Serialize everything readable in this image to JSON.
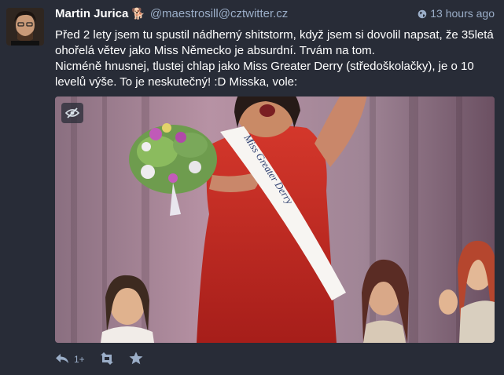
{
  "status": {
    "display_name": "Martin Jurica",
    "emoji": "🐕",
    "acct": "@maestrosill@cztwitter.cz",
    "time": "13 hours ago",
    "content": [
      "Před 2 lety jsem tu spustil nádherný shitstorm, když jsem si dovolil napsat, že 35letá ohořelá větev jako Miss Německo je absurdní. Trvám na tom.",
      "Nicméně hnusnej, tlustej chlap jako Miss Greater Derry (středoškolačky), je o 10 levelů výše. To je neskutečný! :D Misska, vole:"
    ],
    "sash_text": "Miss Greater Derry",
    "reply_count": "1+"
  },
  "icons": {
    "visibility": "globe-icon",
    "hide_media": "eye-slash-icon",
    "reply": "reply-icon",
    "boost": "retweet-icon",
    "favourite": "star-icon"
  },
  "colors": {
    "background": "#282c37",
    "secondary_text": "#9baec8",
    "primary_text": "#ffffff"
  }
}
